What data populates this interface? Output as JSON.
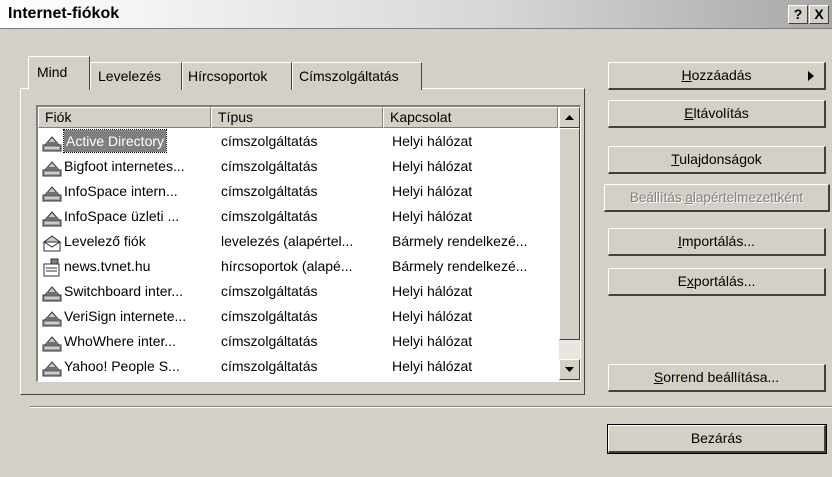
{
  "window": {
    "title": "Internet-fiókok",
    "help_label": "?",
    "close_label": "X"
  },
  "tabs": [
    {
      "label": "Mind"
    },
    {
      "label": "Levelezés"
    },
    {
      "label": "Hírcsoportok"
    },
    {
      "label": "Címszolgáltatás"
    }
  ],
  "list": {
    "columns": [
      "Fiók",
      "Típus",
      "Kapcsolat"
    ],
    "rows": [
      {
        "account": "Active Directory",
        "type": "címszolgáltatás",
        "connection": "Helyi hálózat",
        "icon": "directory-service-icon",
        "selected": true
      },
      {
        "account": "Bigfoot internetes...",
        "type": "címszolgáltatás",
        "connection": "Helyi hálózat",
        "icon": "directory-service-icon"
      },
      {
        "account": "InfoSpace intern...",
        "type": "címszolgáltatás",
        "connection": "Helyi hálózat",
        "icon": "directory-service-icon"
      },
      {
        "account": "InfoSpace üzleti ...",
        "type": "címszolgáltatás",
        "connection": "Helyi hálózat",
        "icon": "directory-service-icon"
      },
      {
        "account": "Levelező fiók",
        "type": "levelezés (alapértel...",
        "connection": "Bármely rendelkezé...",
        "icon": "mail-account-icon"
      },
      {
        "account": "news.tvnet.hu",
        "type": "hírcsoportok (alapé...",
        "connection": "Bármely rendelkezé...",
        "icon": "news-account-icon"
      },
      {
        "account": "Switchboard inter...",
        "type": "címszolgáltatás",
        "connection": "Helyi hálózat",
        "icon": "directory-service-icon"
      },
      {
        "account": "VeriSign internete...",
        "type": "címszolgáltatás",
        "connection": "Helyi hálózat",
        "icon": "directory-service-icon"
      },
      {
        "account": "WhoWhere inter...",
        "type": "címszolgáltatás",
        "connection": "Helyi hálózat",
        "icon": "directory-service-icon"
      },
      {
        "account": "Yahoo! People S...",
        "type": "címszolgáltatás",
        "connection": "Helyi hálózat",
        "icon": "directory-service-icon"
      }
    ]
  },
  "buttons": {
    "add": {
      "label": "Hozzáadás",
      "accel": "H",
      "rest": "ozzáadás"
    },
    "remove": {
      "label": "Eltávolítás",
      "accel": "E",
      "rest": "ltávolítás"
    },
    "properties": {
      "label": "Tulajdonságok",
      "accel": "T",
      "rest": "ulajdonságok"
    },
    "set_default": {
      "label": "Beállítás alapértelmezettként",
      "pre": "Beállítás ",
      "accel": "a",
      "rest": "lapértelmezettként"
    },
    "import": {
      "label": "Importálás...",
      "pre": "",
      "accel": "I",
      "rest": "mportálás..."
    },
    "export": {
      "label": "Exportálás...",
      "pre": "E",
      "accel": "x",
      "rest": "portálás..."
    },
    "set_order": {
      "label": "Sorrend beállítása...",
      "accel": "S",
      "rest": "orrend beállítása..."
    },
    "close": {
      "label": "Bezárás"
    }
  }
}
